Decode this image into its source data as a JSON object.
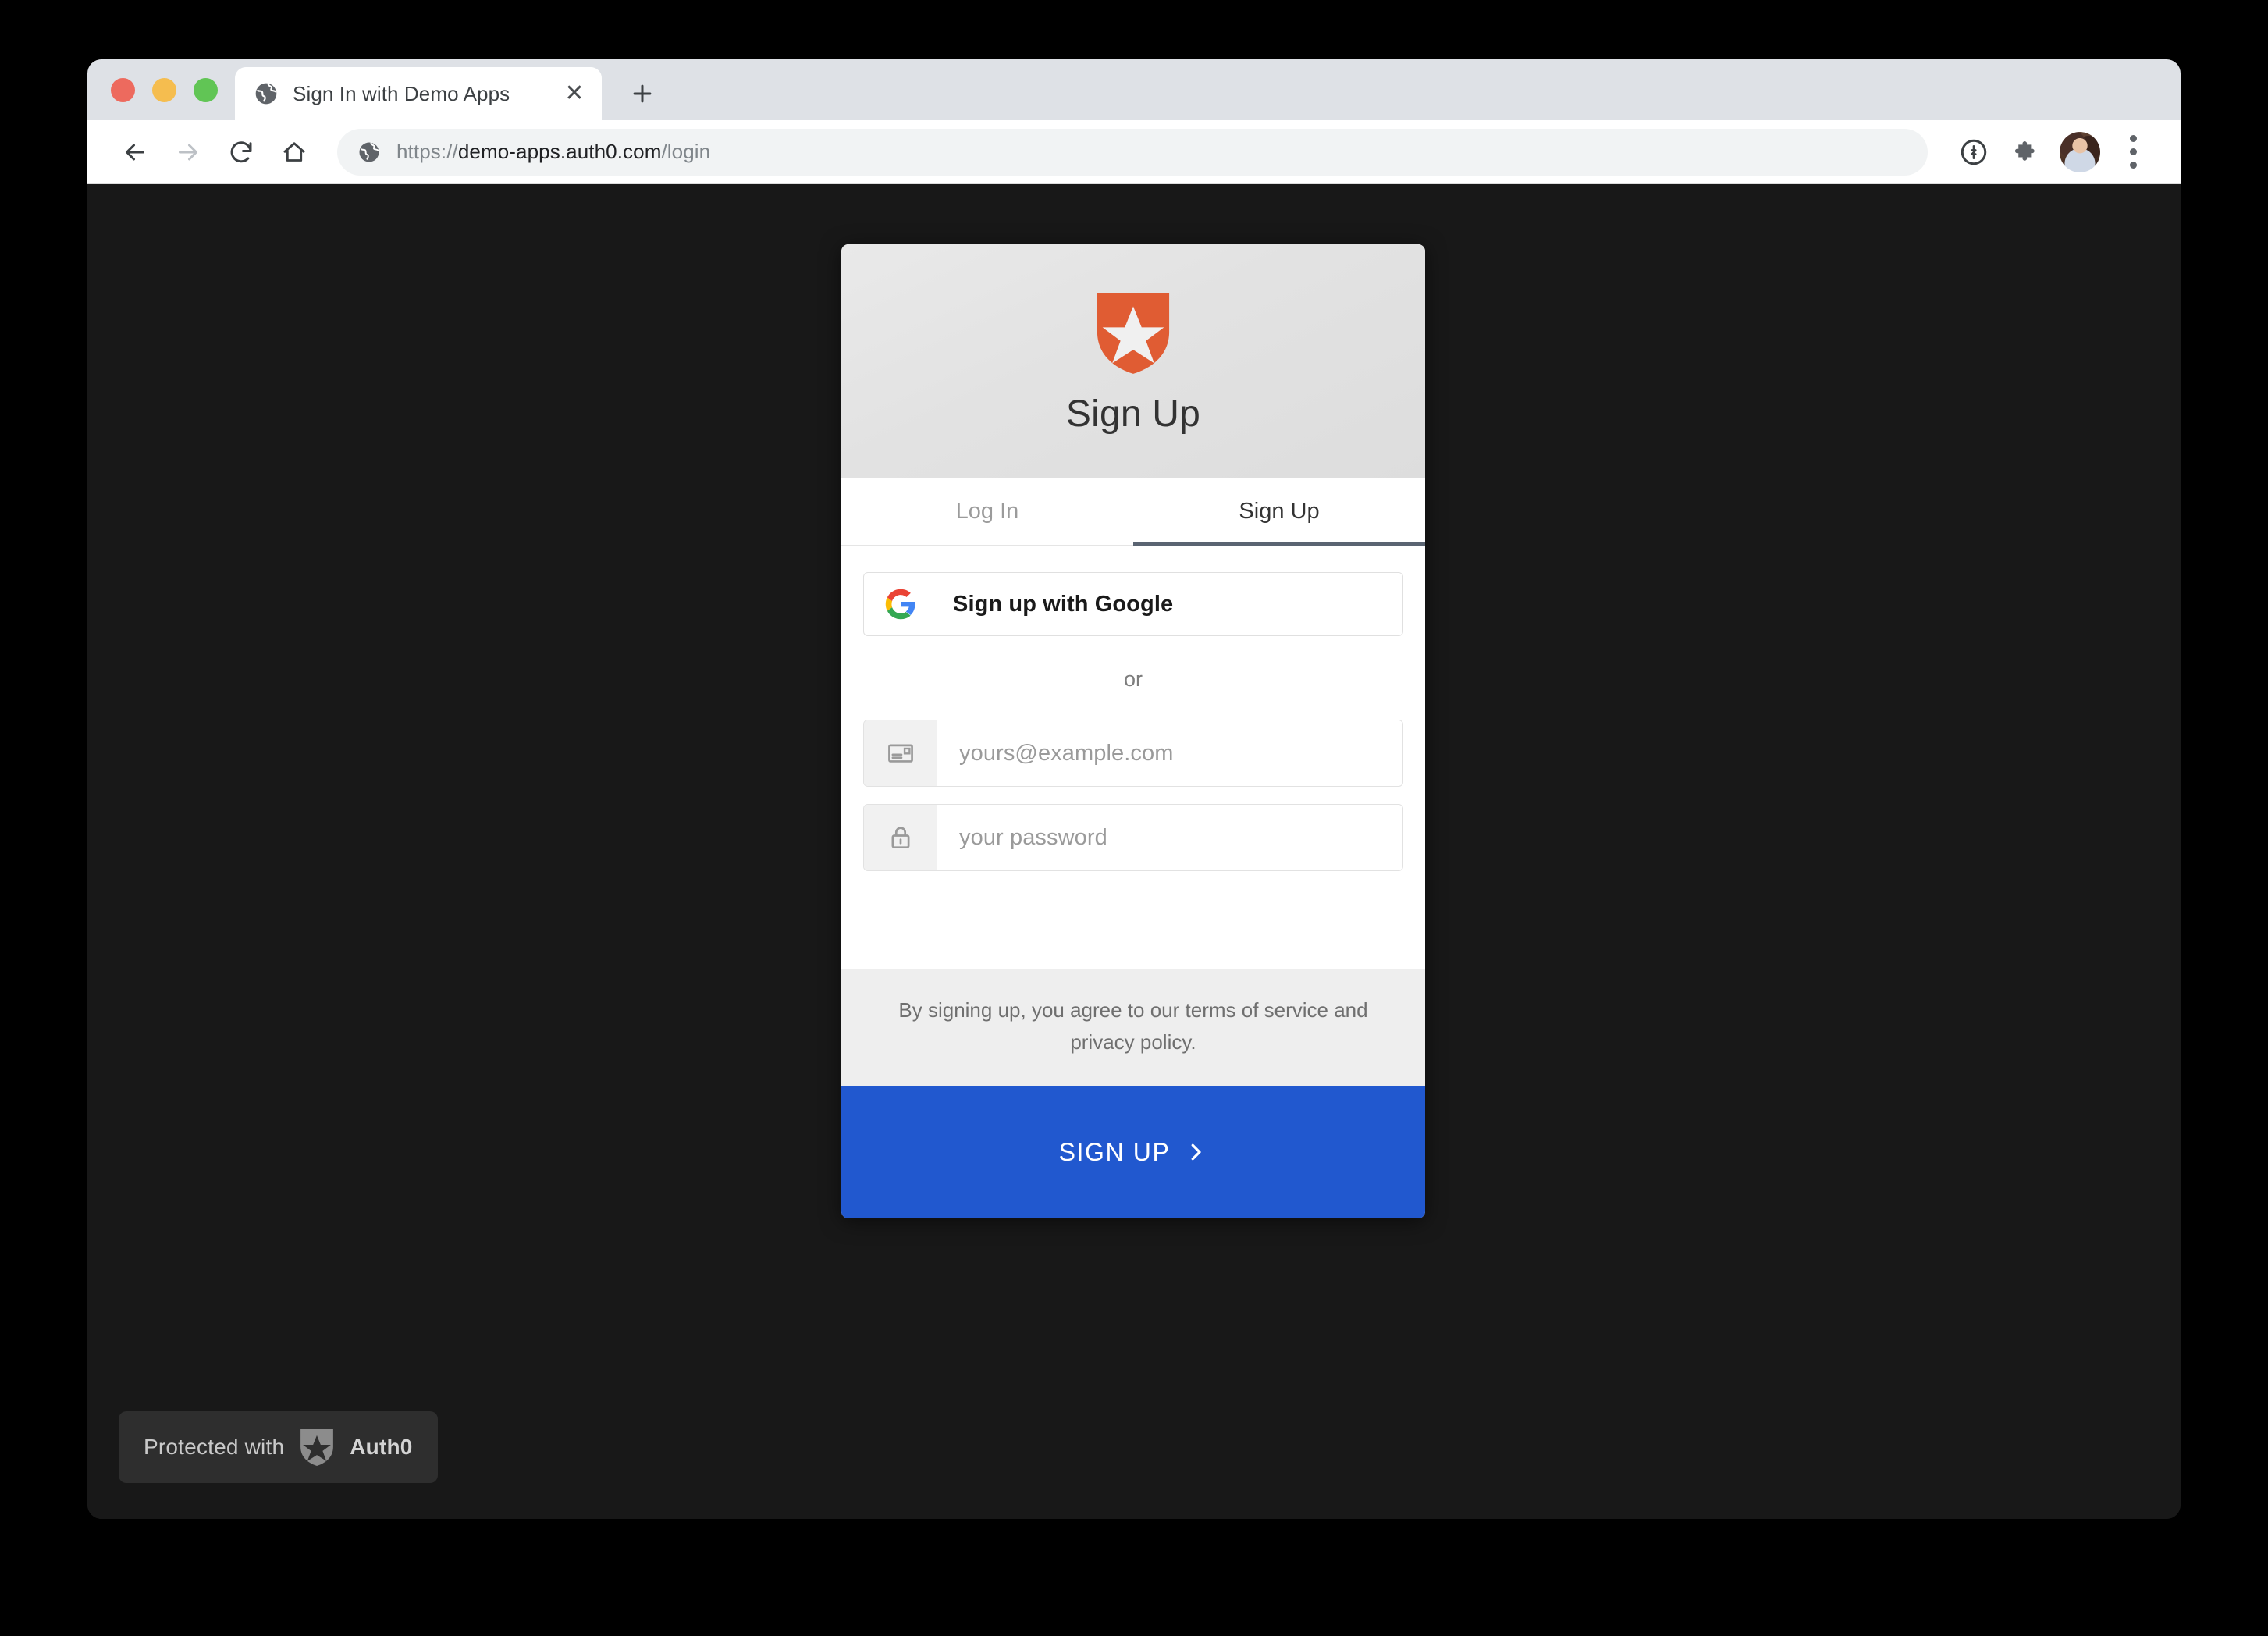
{
  "browser": {
    "traffic_lights": [
      "close",
      "minimize",
      "maximize"
    ],
    "tab": {
      "title": "Sign In with Demo Apps",
      "favicon": "globe-icon",
      "close_label": "✕"
    },
    "new_tab_label": "+",
    "toolbar": {
      "back_icon": "back-arrow-icon",
      "forward_icon": "forward-arrow-icon",
      "reload_icon": "reload-icon",
      "home_icon": "home-icon",
      "url_scheme": "https://",
      "url_host": "demo-apps.auth0.com",
      "url_path": "/login",
      "site_icon": "globe-icon",
      "password_manager_icon": "1password-icon",
      "extensions_icon": "puzzle-piece-icon",
      "profile_icon": "avatar",
      "menu_icon": "three-dot-menu-icon"
    }
  },
  "card": {
    "logo": "auth0-shield-icon",
    "title": "Sign Up",
    "tabs": [
      {
        "label": "Log In",
        "active": false
      },
      {
        "label": "Sign Up",
        "active": true
      }
    ],
    "social": {
      "icon": "google-g-icon",
      "label": "Sign up with Google"
    },
    "divider_label": "or",
    "fields": [
      {
        "icon": "email-icon",
        "placeholder": "yours@example.com",
        "value": ""
      },
      {
        "icon": "lock-icon",
        "placeholder": "your password",
        "value": ""
      }
    ],
    "terms": "By signing up, you agree to our terms of service and privacy policy.",
    "submit": {
      "label": "SIGN UP",
      "chevron": "chevron-right-icon"
    }
  },
  "badge": {
    "text": "Protected with",
    "brand": "Auth0",
    "icon": "auth0-shield-icon"
  },
  "colors": {
    "page_background": "#181818",
    "outer_background": "#000000",
    "auth0_orange": "#e05c33",
    "submit_blue": "#2158cf",
    "tab_strip": "#dee1e6",
    "card_header": "#e3e3e3",
    "active_tab_underline": "#5a6472"
  }
}
